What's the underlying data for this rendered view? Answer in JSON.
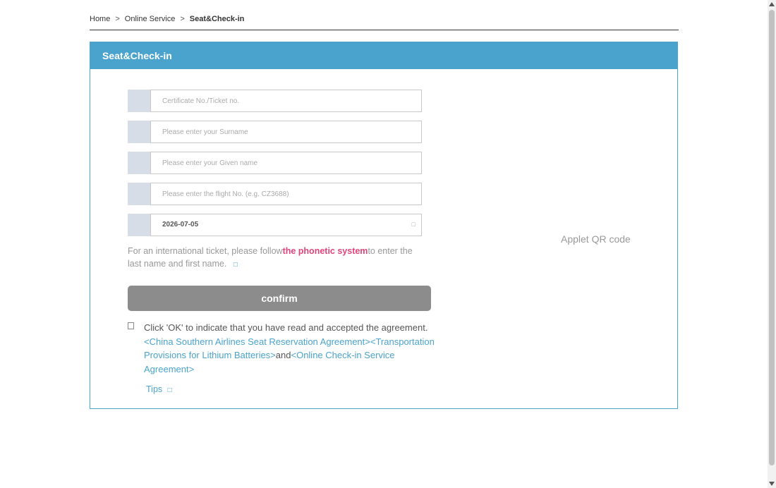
{
  "breadcrumb": {
    "items": [
      "Home",
      "Online Service",
      "Seat&Check-in"
    ],
    "separator": ">"
  },
  "panel": {
    "title": "Seat&Check-in"
  },
  "form": {
    "certificate_placeholder": "Certificate No./Ticket no.",
    "surname_placeholder": "Please enter your Surname",
    "given_name_placeholder": "Please enter your Given name",
    "flight_placeholder": "Please enter the flight No. (e.g. CZ3688)",
    "date_value": "2026-07-05",
    "calendar_icon": "□"
  },
  "note": {
    "prefix": "For an international ticket, please follow",
    "highlight": "the phonetic system",
    "suffix": "to enter the last name and first name.",
    "icon": "□"
  },
  "confirm_label": "confirm",
  "agreement": {
    "checkbox_icon": "",
    "text": "Click 'OK' to indicate that you have read and accepted the agreement.",
    "link1": "<China Southern Airlines Seat Reservation Agreement>",
    "link2": "<Transportation Provisions for Lithium Batteries>",
    "connector": "and",
    "link3": "<Online Check-in Service Agreement>"
  },
  "tips": {
    "label": "Tips",
    "icon": "□"
  },
  "qr_label": "Applet QR code",
  "colors": {
    "header": "#4aa3cd",
    "highlight": "#e0447a",
    "confirm": "#8c8c8c",
    "link": "#4aa3cd"
  }
}
